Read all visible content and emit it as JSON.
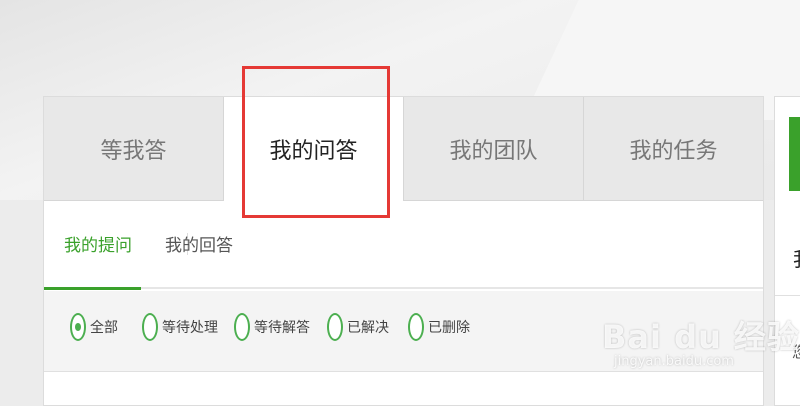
{
  "tabs": [
    {
      "label": "等我答",
      "active": false
    },
    {
      "label": "我的问答",
      "active": true
    },
    {
      "label": "我的团队",
      "active": false
    },
    {
      "label": "我的任务",
      "active": false
    }
  ],
  "subtabs": [
    {
      "label": "我的提问",
      "active": true
    },
    {
      "label": "我的回答",
      "active": false
    }
  ],
  "filters": [
    {
      "label": "全部",
      "checked": true
    },
    {
      "label": "等待处理",
      "checked": false
    },
    {
      "label": "等待解答",
      "checked": false
    },
    {
      "label": "已解决",
      "checked": false
    },
    {
      "label": "已删除",
      "checked": false
    }
  ],
  "right_panel": {
    "title": "我",
    "text": "您"
  },
  "watermark": {
    "main": "Bai du 经验",
    "sub": "jingyan.baidu.com"
  },
  "colors": {
    "accent": "#3aa12b",
    "highlight": "#e53935"
  }
}
